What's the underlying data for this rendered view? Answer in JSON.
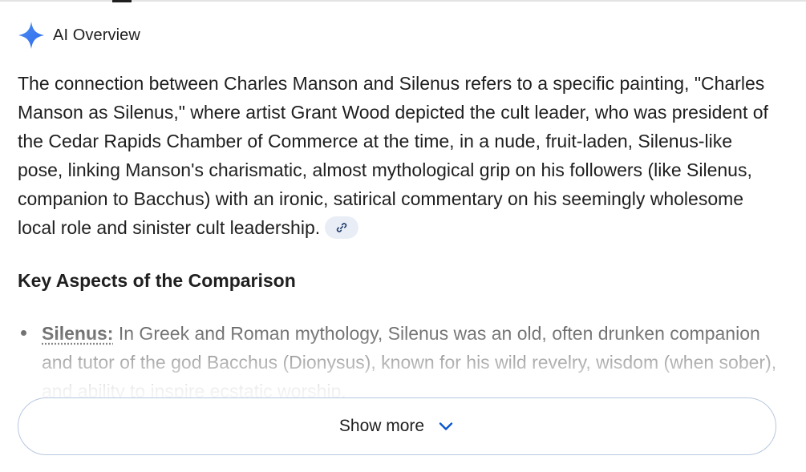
{
  "header": {
    "icon": "ai-sparkle-icon",
    "title": "AI Overview"
  },
  "overview": {
    "paragraph": "The connection between Charles Manson and Silenus refers to a specific painting, \"Charles Manson as Silenus,\" where artist Grant Wood depicted the cult leader, who was president of the Cedar Rapids Chamber of Commerce at the time, in a nude, fruit-laden, Silenus-like pose, linking Manson's charismatic, almost mythological grip on his followers (like Silenus, companion to Bacchus) with an ironic, satirical commentary on his seemingly wholesome local role and sinister cult leadership.",
    "citation_icon": "link-icon"
  },
  "section": {
    "heading": "Key Aspects of the Comparison"
  },
  "bullets": [
    {
      "term": "Silenus:",
      "text": " In Greek and Roman mythology, Silenus was an old, often drunken companion and tutor of the god Bacchus (Dionysus), known for his wild revelry, wisdom (when sober), and ability to inspire ecstatic worship."
    }
  ],
  "show_more": {
    "label": "Show more",
    "icon": "chevron-down-icon"
  },
  "colors": {
    "sparkle_blue": "#4285f4",
    "chip_background": "#e9eef6",
    "chevron_blue": "#0b57d0",
    "button_border": "#b8c7e0",
    "text": "#1f1f1f"
  }
}
